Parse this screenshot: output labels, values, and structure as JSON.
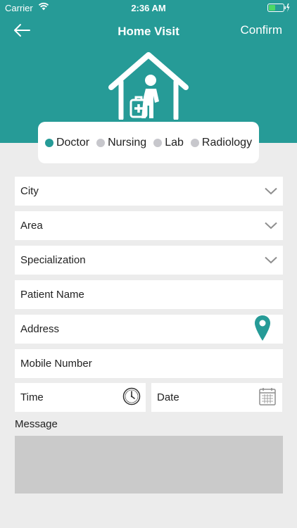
{
  "status_bar": {
    "carrier": "Carrier",
    "time": "2:36 AM",
    "battery_color": "#4cd964"
  },
  "nav": {
    "back_icon": "arrow-left-icon",
    "title": "Home Visit",
    "confirm_label": "Confirm"
  },
  "colors": {
    "primary": "#269b97",
    "background": "#ececec",
    "inactive_dot": "#c7c7cc",
    "message_box": "#cacaca"
  },
  "hero": {
    "icon": "home-visit-doctor-icon"
  },
  "visit_types": [
    {
      "label": "Doctor",
      "selected": true
    },
    {
      "label": "Nursing",
      "selected": false
    },
    {
      "label": "Lab",
      "selected": false
    },
    {
      "label": "Radiology",
      "selected": false
    }
  ],
  "form": {
    "city": {
      "placeholder": "City",
      "icon": "chevron-down-icon"
    },
    "area": {
      "placeholder": "Area",
      "icon": "chevron-down-icon"
    },
    "specialization": {
      "placeholder": "Specialization",
      "icon": "chevron-down-icon"
    },
    "patient_name": {
      "placeholder": "Patient Name"
    },
    "address": {
      "placeholder": "Address",
      "icon": "location-pin-icon"
    },
    "mobile_number": {
      "placeholder": "Mobile Number"
    },
    "time": {
      "placeholder": "Time",
      "icon": "clock-icon"
    },
    "date": {
      "placeholder": "Date",
      "icon": "calendar-icon"
    },
    "message_label": "Message"
  }
}
